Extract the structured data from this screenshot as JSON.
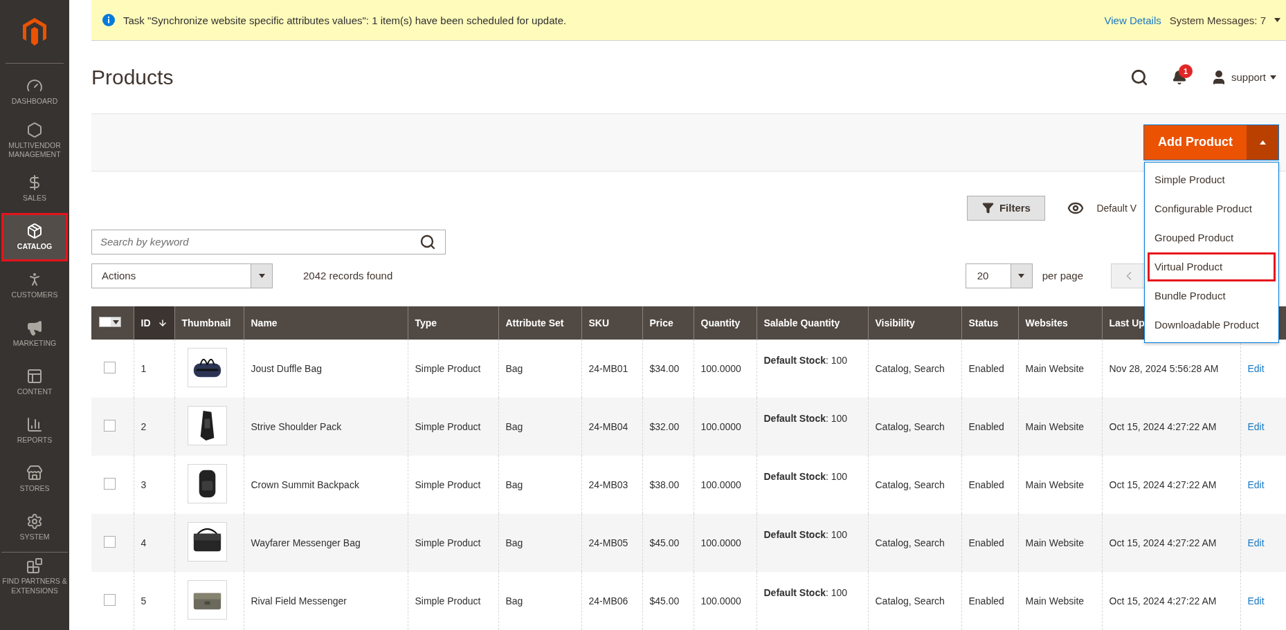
{
  "sidebar": {
    "items": [
      {
        "label": "DASHBOARD",
        "selected": false,
        "highlighted": false
      },
      {
        "label": "MULTIVENDOR MANAGEMENT",
        "selected": false,
        "highlighted": false
      },
      {
        "label": "SALES",
        "selected": false,
        "highlighted": false
      },
      {
        "label": "CATALOG",
        "selected": true,
        "highlighted": true
      },
      {
        "label": "CUSTOMERS",
        "selected": false,
        "highlighted": false
      },
      {
        "label": "MARKETING",
        "selected": false,
        "highlighted": false
      },
      {
        "label": "CONTENT",
        "selected": false,
        "highlighted": false
      },
      {
        "label": "REPORTS",
        "selected": false,
        "highlighted": false
      },
      {
        "label": "STORES",
        "selected": false,
        "highlighted": false
      },
      {
        "label": "SYSTEM",
        "selected": false,
        "highlighted": false
      },
      {
        "label": "FIND PARTNERS & EXTENSIONS",
        "selected": false,
        "highlighted": false
      }
    ]
  },
  "notice": {
    "message": "Task \"Synchronize website specific attributes values\": 1 item(s) have been scheduled for update.",
    "link": "View Details",
    "system_messages": "System Messages: 7"
  },
  "header": {
    "title": "Products",
    "notification_count": "1",
    "user": "support"
  },
  "action_bar": {
    "add_button": "Add Product",
    "menu": {
      "expanded": true,
      "items": [
        {
          "label": "Simple Product",
          "highlighted": false
        },
        {
          "label": "Configurable Product",
          "highlighted": false
        },
        {
          "label": "Grouped Product",
          "highlighted": false
        },
        {
          "label": "Virtual Product",
          "highlighted": true
        },
        {
          "label": "Bundle Product",
          "highlighted": false
        },
        {
          "label": "Downloadable Product",
          "highlighted": false
        }
      ]
    }
  },
  "toolbar": {
    "filters": "Filters",
    "view": "Default V",
    "search": {
      "placeholder": "Search by keyword"
    },
    "actions": "Actions",
    "records": "2042 records found",
    "page_size": "20",
    "per_page": "per page"
  },
  "table": {
    "select_all": {
      "checked": false
    },
    "columns": [
      {
        "label": "ID",
        "sorted": true
      },
      {
        "label": "Thumbnail",
        "sorted": false
      },
      {
        "label": "Name",
        "sorted": false
      },
      {
        "label": "Type",
        "sorted": false
      },
      {
        "label": "Attribute Set",
        "sorted": false
      },
      {
        "label": "SKU",
        "sorted": false
      },
      {
        "label": "Price",
        "sorted": false
      },
      {
        "label": "Quantity",
        "sorted": false
      },
      {
        "label": "Salable Quantity",
        "sorted": false
      },
      {
        "label": "Visibility",
        "sorted": false
      },
      {
        "label": "Status",
        "sorted": false
      },
      {
        "label": "Websites",
        "sorted": false
      },
      {
        "label": "Last Up",
        "sorted": false
      }
    ],
    "rows": [
      {
        "checked": false,
        "cells": [
          "1",
          "",
          "Joust Duffle Bag",
          "Simple Product",
          "Bag",
          "24-MB01",
          "$34.00",
          "100.0000",
          "**Default Stock**: 100",
          "Catalog, Search",
          "Enabled",
          "Main Website",
          "Nov 28, 2024 5:56:28 AM"
        ],
        "action": "Edit"
      },
      {
        "checked": false,
        "cells": [
          "2",
          "",
          "Strive Shoulder Pack",
          "Simple Product",
          "Bag",
          "24-MB04",
          "$32.00",
          "100.0000",
          "**Default Stock**: 100",
          "Catalog, Search",
          "Enabled",
          "Main Website",
          "Oct 15, 2024 4:27:22 AM"
        ],
        "action": "Edit"
      },
      {
        "checked": false,
        "cells": [
          "3",
          "",
          "Crown Summit Backpack",
          "Simple Product",
          "Bag",
          "24-MB03",
          "$38.00",
          "100.0000",
          "**Default Stock**: 100",
          "Catalog, Search",
          "Enabled",
          "Main Website",
          "Oct 15, 2024 4:27:22 AM"
        ],
        "action": "Edit"
      },
      {
        "checked": false,
        "cells": [
          "4",
          "",
          "Wayfarer Messenger Bag",
          "Simple Product",
          "Bag",
          "24-MB05",
          "$45.00",
          "100.0000",
          "**Default Stock**: 100",
          "Catalog, Search",
          "Enabled",
          "Main Website",
          "Oct 15, 2024 4:27:22 AM"
        ],
        "action": "Edit"
      },
      {
        "checked": false,
        "cells": [
          "5",
          "",
          "Rival Field Messenger",
          "Simple Product",
          "Bag",
          "24-MB06",
          "$45.00",
          "100.0000",
          "**Default Stock**: 100",
          "Catalog, Search",
          "Enabled",
          "Main Website",
          "Oct 15, 2024 4:27:22 AM"
        ],
        "action": "Edit"
      }
    ]
  }
}
